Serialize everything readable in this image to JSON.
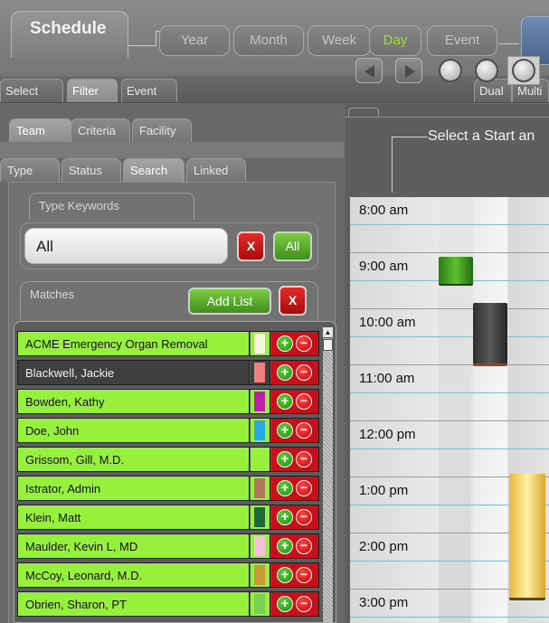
{
  "header": {
    "title": "Schedule",
    "views": [
      {
        "label": "Year",
        "active": false
      },
      {
        "label": "Month",
        "active": false
      },
      {
        "label": "Week",
        "active": false
      },
      {
        "label": "Day",
        "active": true
      },
      {
        "label": "Event",
        "active": false
      }
    ]
  },
  "toolbar": {
    "tabs": [
      {
        "label": "Select",
        "active": false
      },
      {
        "label": "Filter",
        "active": true
      },
      {
        "label": "Event",
        "active": false
      }
    ],
    "right_tabs": [
      {
        "label": "Dual"
      },
      {
        "label": "Multi"
      }
    ]
  },
  "filter": {
    "tabs": [
      {
        "label": "Team",
        "active": true
      },
      {
        "label": "Criteria",
        "active": false
      },
      {
        "label": "Facility",
        "active": false
      }
    ],
    "subtabs": [
      {
        "label": "Type",
        "active": false
      },
      {
        "label": "Status",
        "active": false
      },
      {
        "label": "Search",
        "active": true
      },
      {
        "label": "Linked",
        "active": false
      }
    ],
    "keywords_label": "Type Keywords",
    "keywords_value": "All",
    "clear_label": "X",
    "all_label": "All",
    "matches_label": "Matches",
    "add_list_label": "Add List",
    "matches_clear_label": "X"
  },
  "matches": [
    {
      "name": "ACME Emergency Organ Removal",
      "color": "#f7f7e0",
      "selected": false
    },
    {
      "name": "Blackwell, Jackie",
      "color": "#f08080",
      "selected": true
    },
    {
      "name": "Bowden, Kathy",
      "color": "#c020a8",
      "selected": false
    },
    {
      "name": "Doe, John",
      "color": "#2aa8e0",
      "selected": false
    },
    {
      "name": "Grissom, Gill, M.D.",
      "color": "#97f03b",
      "selected": false
    },
    {
      "name": "Istrator, Admin",
      "color": "#b07a5a",
      "selected": false
    },
    {
      "name": "Klein, Matt",
      "color": "#1c6a3a",
      "selected": false
    },
    {
      "name": "Maulder, Kevin L, MD",
      "color": "#f6c0d8",
      "selected": false
    },
    {
      "name": "McCoy, Leonard, M.D.",
      "color": "#c89a3c",
      "selected": false
    },
    {
      "name": "Obrien, Sharon, PT",
      "color": "#7ad050",
      "selected": false
    }
  ],
  "row_icons": {
    "add": "plus-icon",
    "remove": "minus-icon"
  },
  "calendar": {
    "prompt": "Select a Start an",
    "times": [
      "8:00 am",
      "9:00 am",
      "10:00 am",
      "11:00 am",
      "12:00 pm",
      "1:00 pm",
      "2:00 pm",
      "3:00 pm"
    ],
    "icons": [
      "prev-arrow-icon",
      "next-arrow-icon",
      "clock-icon",
      "clock-icon",
      "clock-icon"
    ]
  }
}
